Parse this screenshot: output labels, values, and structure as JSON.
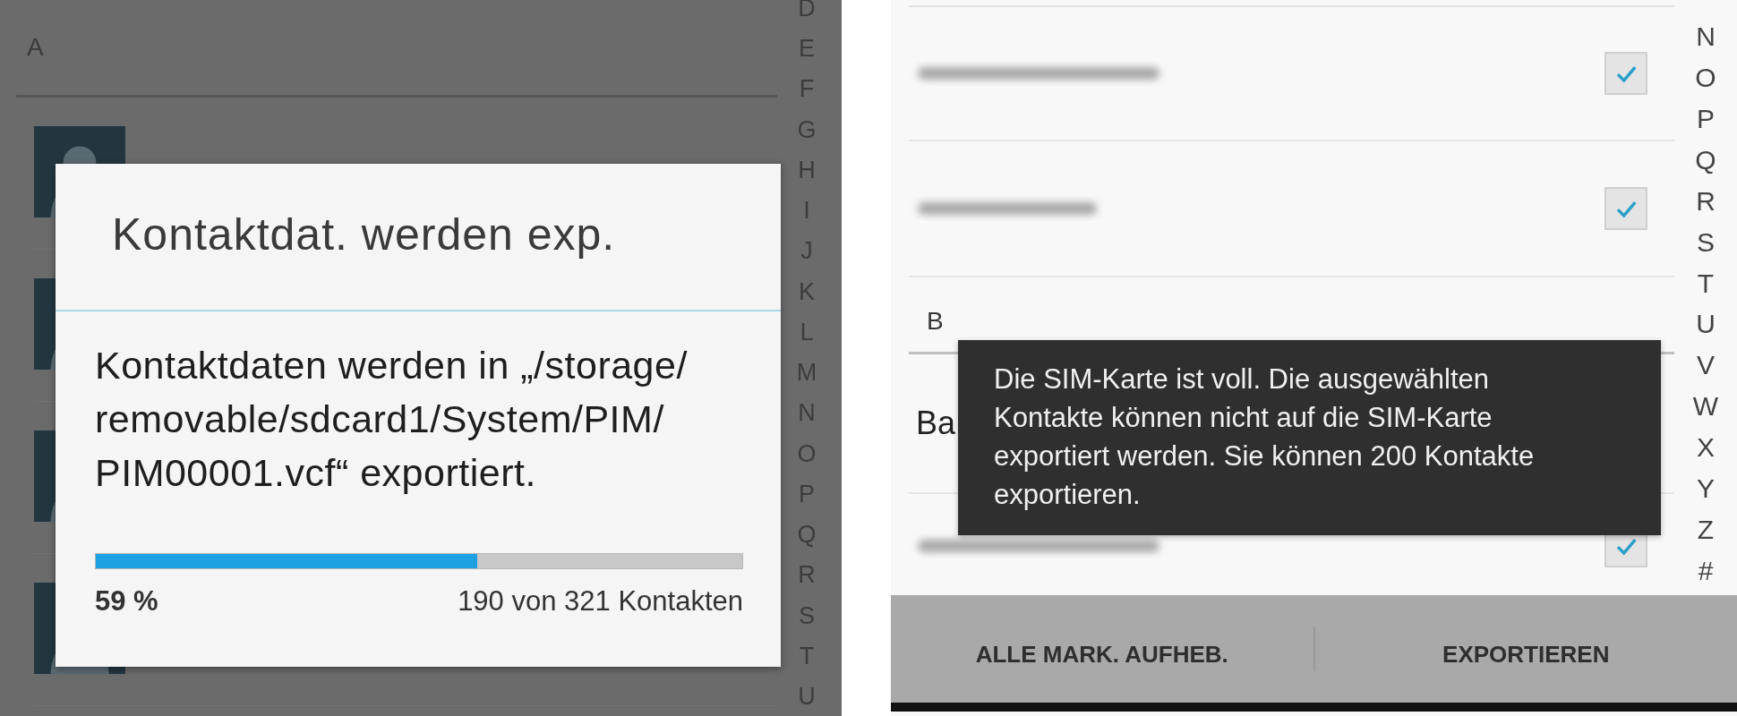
{
  "left": {
    "section": "A",
    "index": [
      "D",
      "E",
      "F",
      "G",
      "H",
      "I",
      "J",
      "K",
      "L",
      "M",
      "N",
      "O",
      "P",
      "Q",
      "R",
      "S",
      "T",
      "U"
    ],
    "dialog": {
      "title": "Kontaktdat. werden exp.",
      "message": "Kontaktdaten werden in „/storage/ removable/sdcard1/System/PIM/ PIM00001.vcf“ exportiert.",
      "progress": {
        "level": 0.59
      },
      "percent": "59 %",
      "count": "190 von 321 Kontakten"
    }
  },
  "right": {
    "index": [
      "N",
      "O",
      "P",
      "Q",
      "R",
      "S",
      "T",
      "U",
      "V",
      "W",
      "X",
      "Y",
      "Z",
      "#"
    ],
    "rows": [
      {
        "kind": "contact",
        "checked": true
      },
      {
        "kind": "contact",
        "checked": true
      },
      {
        "kind": "header",
        "label": "B"
      },
      {
        "kind": "named",
        "name": "Ba"
      },
      {
        "kind": "contact",
        "checked": true
      }
    ],
    "toast": "Die SIM-Karte ist voll. Die ausgewählten Kontakte können nicht auf die SIM-Karte exportiert werden. Sie können 200 Kontakte exportieren.",
    "buttons": [
      "ALLE MARK. AUFHEB.",
      "EXPORTIEREN"
    ]
  }
}
